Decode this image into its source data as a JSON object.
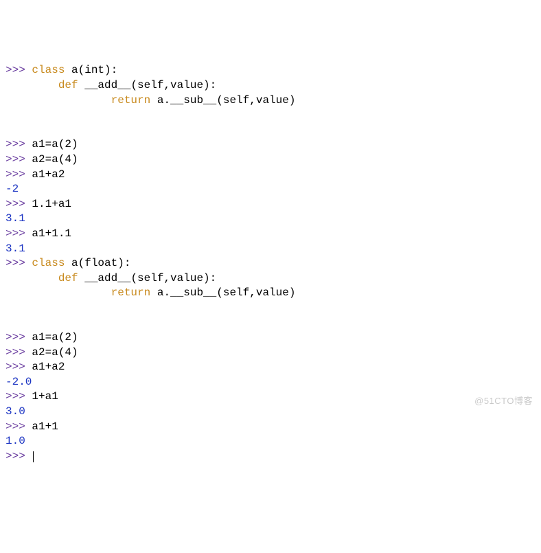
{
  "lines": [
    {
      "pre": ">>> ",
      "kw": "class",
      "rest": " a(int):"
    },
    {
      "indent": "        ",
      "kw": "def",
      "rest": " __add__(self,value):"
    },
    {
      "indent": "                ",
      "kw": "return",
      "rest": " a.__sub__(self,value)"
    },
    {
      "blank": true
    },
    {
      "blank": true
    },
    {
      "pre": ">>> ",
      "rest": "a1=a(2)"
    },
    {
      "pre": ">>> ",
      "rest": "a2=a(4)"
    },
    {
      "pre": ">>> ",
      "rest": "a1+a2"
    },
    {
      "out": "-2"
    },
    {
      "pre": ">>> ",
      "rest": "1.1+a1"
    },
    {
      "out": "3.1"
    },
    {
      "pre": ">>> ",
      "rest": "a1+1.1"
    },
    {
      "out": "3.1"
    },
    {
      "pre": ">>> ",
      "kw": "class",
      "rest": " a(float):"
    },
    {
      "indent": "        ",
      "kw": "def",
      "rest": " __add__(self,value):"
    },
    {
      "indent": "                ",
      "kw": "return",
      "rest": " a.__sub__(self,value)"
    },
    {
      "blank": true
    },
    {
      "blank": true
    },
    {
      "pre": ">>> ",
      "rest": "a1=a(2)"
    },
    {
      "pre": ">>> ",
      "rest": "a2=a(4)"
    },
    {
      "pre": ">>> ",
      "rest": "a1+a2"
    },
    {
      "out": "-2.0"
    },
    {
      "pre": ">>> ",
      "rest": "1+a1"
    },
    {
      "out": "3.0"
    },
    {
      "pre": ">>> ",
      "rest": "a1+1"
    },
    {
      "out": "1.0"
    },
    {
      "pre": ">>> ",
      "cursor": true
    }
  ],
  "watermark": "@51CTO博客"
}
